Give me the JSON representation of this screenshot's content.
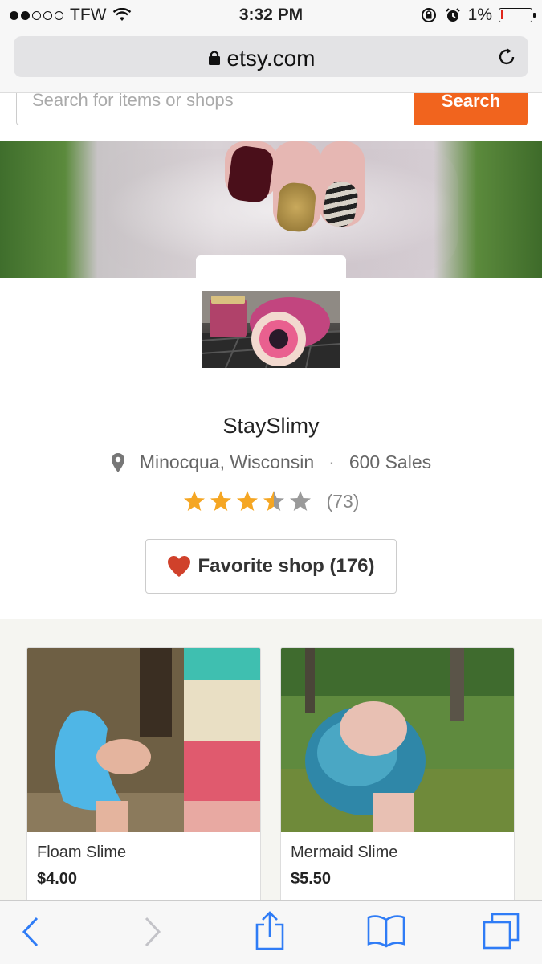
{
  "status_bar": {
    "carrier": "TFW",
    "time": "3:32 PM",
    "battery_percent": "1%",
    "battery_level": 0.01,
    "signal_bars_filled": 2,
    "signal_bars_total": 5
  },
  "browser": {
    "domain": "etsy.com"
  },
  "search": {
    "placeholder": "Search for items or shops",
    "button_label": "Search"
  },
  "shop": {
    "name": "StaySlimy",
    "location": "Minocqua, Wisconsin",
    "separator": "·",
    "sales": "600 Sales",
    "rating": 3.5,
    "rating_max": 5,
    "review_count": "(73)",
    "favorite_label": "Favorite shop (176)"
  },
  "listings": [
    {
      "title": "Floam Slime",
      "price": "$4.00"
    },
    {
      "title": "Mermaid Slime",
      "price": "$5.50"
    }
  ],
  "colors": {
    "accent": "#f1641e",
    "star": "#f5a623",
    "star_empty": "#9a9a9a",
    "heart": "#d0412b",
    "ios_blue": "#2f7cf6"
  },
  "icons": {
    "location": "map-pin-icon",
    "favorite": "heart-icon",
    "lock": "lock-icon",
    "reload": "reload-icon",
    "back": "chevron-left-icon",
    "forward": "chevron-right-icon",
    "share": "share-icon",
    "bookmarks": "book-icon",
    "tabs": "tabs-icon"
  }
}
